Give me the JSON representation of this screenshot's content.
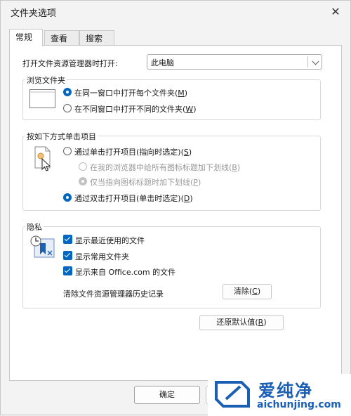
{
  "window": {
    "title": "文件夹选项",
    "close_glyph": "✕"
  },
  "tabs": [
    {
      "label": "常规"
    },
    {
      "label": "查看"
    },
    {
      "label": "搜索"
    }
  ],
  "general": {
    "open_label": "打开文件资源管理器时打开:",
    "open_value": "此电脑",
    "browse": {
      "title": "浏览文件夹",
      "option_same": "在同一窗口中打开每个文件夹",
      "option_same_key": "M",
      "option_new": "在不同窗口中打开不同的文件夹",
      "option_new_key": "W"
    },
    "click": {
      "title": "按如下方式单击项目",
      "single": "通过单击打开项目(指向时选定)",
      "single_key": "S",
      "underline_browser": "在我的浏览器中给所有图标标题加下划线",
      "underline_browser_key": "B",
      "underline_point": "仅当指向图标标题时加下划线",
      "underline_point_key": "P",
      "double": "通过双击打开项目(单击时选定)",
      "double_key": "D"
    },
    "privacy": {
      "title": "隐私",
      "recent_files": "显示最近使用的文件",
      "frequent_folders": "显示常用文件夹",
      "office_files": "显示来自 Office.com 的文件",
      "clear_label": "清除文件资源管理器历史记录",
      "clear_button": "清除",
      "clear_key": "C"
    },
    "restore_button": "还原默认值",
    "restore_key": "R"
  },
  "footer": {
    "ok": "确定"
  },
  "watermark": {
    "brand": "爱纯净",
    "url": "aichunjing.com"
  },
  "colors": {
    "accent": "#0067c0",
    "watermark_blue": "#1a5fb4"
  }
}
